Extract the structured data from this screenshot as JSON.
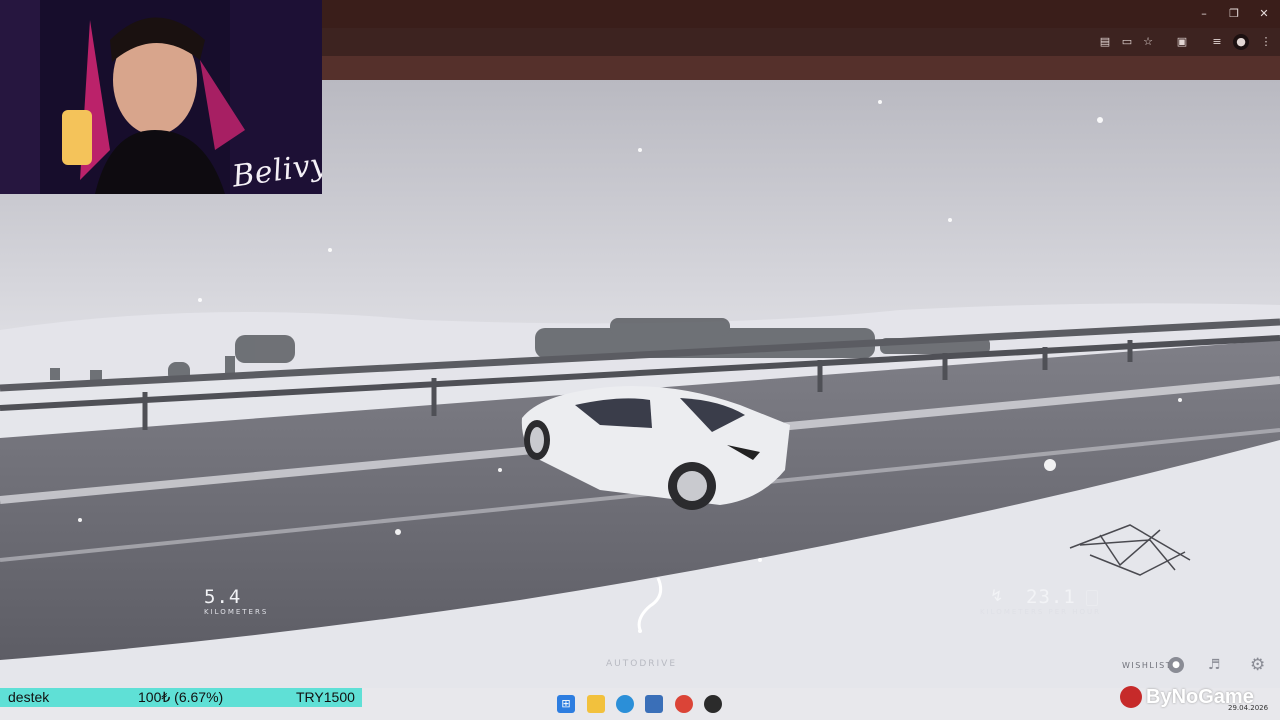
{
  "window_controls": {
    "minimize_icon": "minimize-icon",
    "restore_icon": "restore-icon",
    "close_icon": "close-icon"
  },
  "toolbar_icons": [
    "translate-icon",
    "install-app-icon",
    "bookmark-star-icon",
    "extensions-icon",
    "media-control-icon",
    "profile-icon",
    "more-icon"
  ],
  "webcam": {
    "signature": "Belivyr"
  },
  "hud": {
    "distance_value": "5.4",
    "distance_label": "KILOMETERS",
    "speed_value": "23.1",
    "speed_label": "KILOMETERS PER HOUR",
    "autodrive_label": "AUTODRIVE",
    "wishlist_label": "WISHLIST"
  },
  "donation_goal": {
    "label": "destek",
    "progress_text": "100₺ (6.67%)",
    "goal": "TRY1500",
    "progress_fraction": 0.0667,
    "fill_color": "#5fe0d6"
  },
  "taskbar": {
    "apps": [
      "windows-start-icon",
      "file-explorer-icon",
      "edge-icon",
      "store-icon",
      "chrome-icon",
      "obs-icon"
    ],
    "watermark": "ByNoGame",
    "date": "29.04.2026"
  },
  "colors": {
    "browser_frame": "#3a1e1a",
    "snow": "#dcdde2",
    "road": "#6e6e76"
  }
}
